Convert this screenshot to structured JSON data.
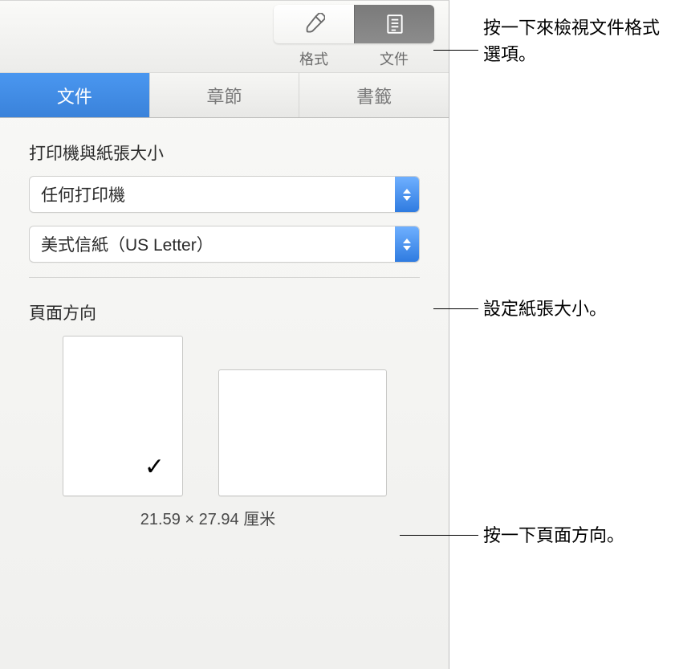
{
  "toolbar": {
    "format_label": "格式",
    "document_label": "文件"
  },
  "tabs": {
    "document": "文件",
    "section": "章節",
    "bookmark": "書籤"
  },
  "printer_section": {
    "heading": "打印機與紙張大小",
    "printer_value": "任何打印機",
    "paper_value": "美式信紙（US Letter）"
  },
  "orientation_section": {
    "heading": "頁面方向",
    "dimensions": "21.59 × 27.94 厘米",
    "checkmark": "✓"
  },
  "annotations": {
    "view_options": "按一下來檢視文件格式選項。",
    "paper_size": "設定紙張大小。",
    "orientation": "按一下頁面方向。"
  }
}
